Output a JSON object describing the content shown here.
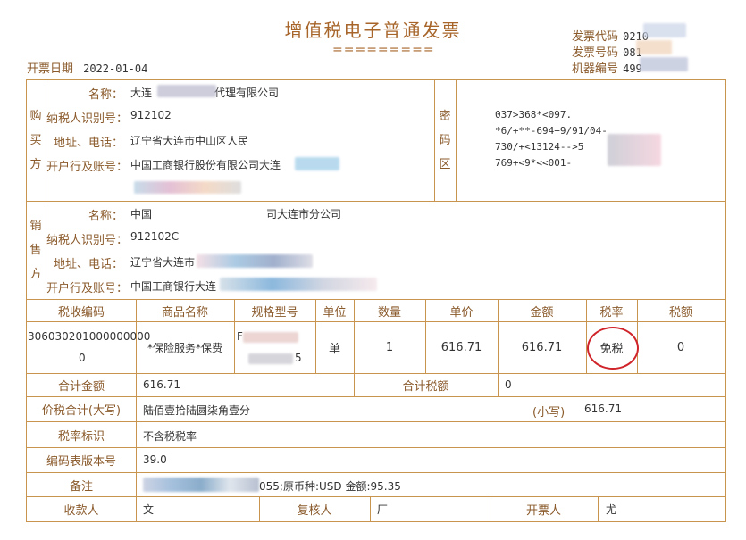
{
  "title": "增值税电子普通发票",
  "title_rule": "=========",
  "header": {
    "invoice_date_label": "开票日期",
    "invoice_date": "2022-01-04",
    "code_label": "发票代码",
    "code_value": "0210",
    "number_label": "发票号码",
    "number_value": "081",
    "machine_label": "机器编号",
    "machine_value": "499"
  },
  "buyer": {
    "section": [
      "购",
      "买",
      "方"
    ],
    "name_label": "名称：",
    "name_value": "大连",
    "name_suffix": "代理有限公司",
    "tax_id_label": "纳税人识别号：",
    "tax_id_value": "912102",
    "addr_label": "地址、电话：",
    "addr_value": "辽宁省大连市中山区人民",
    "bank_label": "开户行及账号：",
    "bank_value": "中国工商银行股份有限公司大连"
  },
  "password": {
    "section": [
      "密",
      "码",
      "区"
    ],
    "lines": [
      "037>368*<097.",
      "*6/+**-694+9/91/04-",
      "730/+<13124-->5",
      "769+<9*<<001-"
    ]
  },
  "seller": {
    "section": [
      "销",
      "售",
      "方"
    ],
    "name_label": "名称：",
    "name_value": "中国",
    "name_suffix": "司大连市分公司",
    "tax_id_label": "纳税人识别号：",
    "tax_id_value": "912102C",
    "addr_label": "地址、电话：",
    "addr_value": "辽宁省大连市",
    "bank_label": "开户行及账号：",
    "bank_value": "中国工商银行大连"
  },
  "table": {
    "headers": [
      "税收编码",
      "商品名称",
      "规格型号",
      "单位",
      "数量",
      "单价",
      "金额",
      "税率",
      "税额"
    ],
    "row": {
      "tax_code_1": "306030201000000000",
      "tax_code_2": "0",
      "item_name": "*保险服务*保费",
      "spec_1": "F",
      "spec_2": "5",
      "unit": "单",
      "qty": "1",
      "unit_price": "616.71",
      "amount": "616.71",
      "tax_rate": "免税",
      "tax": "0"
    }
  },
  "totals": {
    "amount_label": "合计金额",
    "amount_value": "616.71",
    "tax_label": "合计税额",
    "tax_value": "0",
    "grand_label": "价税合计(大写)",
    "grand_upper": "陆佰壹拾陆圆柒角壹分",
    "grand_small_label": "(小写)",
    "grand_small_value": "616.71"
  },
  "rate_mark": {
    "label": "税率标识",
    "value": "不含税税率"
  },
  "code_version": {
    "label": "编码表版本号",
    "value": "39.0"
  },
  "remark": {
    "label": "备注",
    "value": "055;原币种:USD 金额:95.35"
  },
  "footer": {
    "payee_label": "收款人",
    "payee_value": "文",
    "reviewer_label": "复核人",
    "reviewer_value": "厂",
    "issuer_label": "开票人",
    "issuer_value": "尤"
  },
  "colors": {
    "border": "#c8944e",
    "label": "#8a5a2b",
    "circle": "#d0242b"
  }
}
